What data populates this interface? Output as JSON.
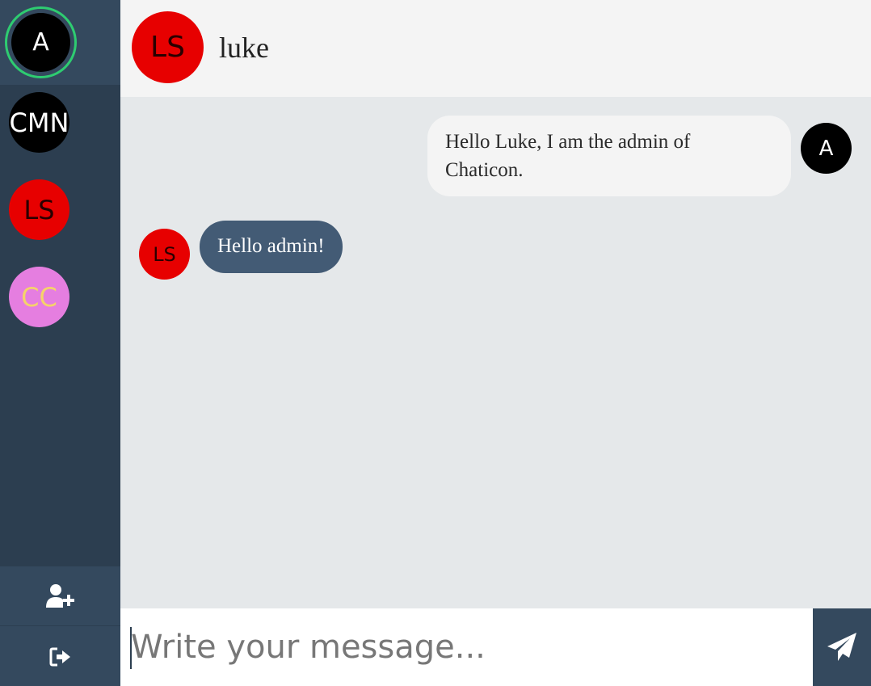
{
  "sidebar": {
    "current_user": {
      "initials": "A",
      "bg": "#000000",
      "fg": "#ffffff",
      "status_color": "#2ecc71"
    },
    "contacts": [
      {
        "initials": "CMN",
        "bg": "#000000",
        "fg": "#ffffff"
      },
      {
        "initials": "LS",
        "bg": "#e70000",
        "fg": "#2a0000"
      },
      {
        "initials": "CC",
        "bg": "#e57ee0",
        "fg": "#f5d36a"
      }
    ],
    "actions": [
      {
        "icon": "add-user-icon"
      },
      {
        "icon": "logout-icon"
      }
    ]
  },
  "header": {
    "avatar_initials": "LS",
    "avatar_bg": "#e70000",
    "name": "luke"
  },
  "messages": [
    {
      "direction": "outgoing",
      "avatar_initials": "A",
      "text": "Hello Luke, I am the admin of Chaticon."
    },
    {
      "direction": "incoming",
      "avatar_initials": "LS",
      "text": "Hello admin!"
    }
  ],
  "composer": {
    "placeholder": "Write your message...",
    "value": "",
    "send_icon": "paper-plane-icon"
  }
}
